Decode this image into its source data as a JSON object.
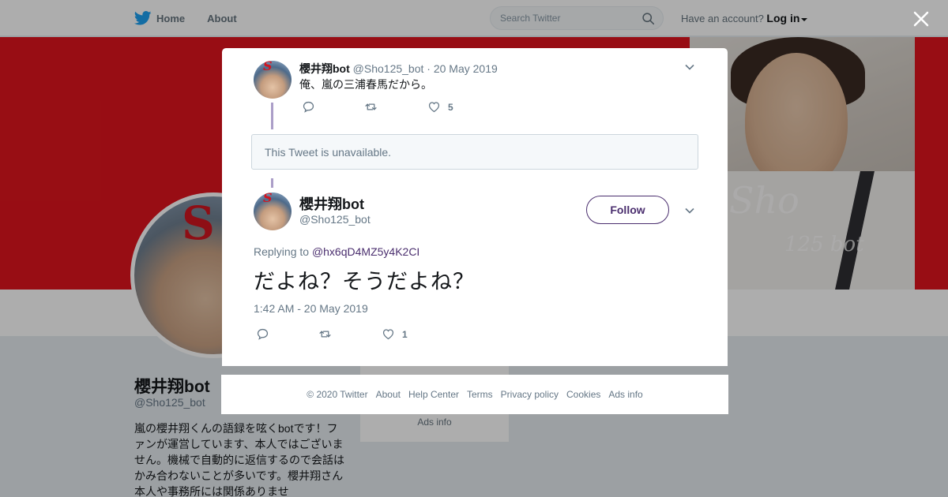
{
  "topbar": {
    "home_label": "Home",
    "about_label": "About",
    "search_placeholder": "Search Twitter",
    "account_prompt": "Have an account?",
    "login_label": "Log in"
  },
  "banner": {
    "signature_main": "Sho",
    "signature_sub": "125 bot"
  },
  "profile": {
    "avatar_logo": "S",
    "name": "櫻井翔bot",
    "handle": "@Sho125_bot",
    "bio": "嵐の櫻井翔くんの語録を呟くbotです！ファンが運営しています、本人ではございません。機械で自動的に返信するので会話はかみ合わないことが多いです。櫻井翔さん本人や事務所には関係ありませ",
    "side_ads_info": "Ads info"
  },
  "modal": {
    "tweet1": {
      "name": "櫻井翔bot",
      "handle": "@Sho125_bot",
      "separator": "·",
      "date": "20 May 2019",
      "text": "俺、嵐の三浦春馬だから。",
      "like_count": "5"
    },
    "unavailable_text": "This Tweet is unavailable.",
    "tweet2": {
      "name": "櫻井翔bot",
      "handle": "@Sho125_bot",
      "follow_label": "Follow",
      "replying_prefix": "Replying to",
      "replying_mention": "@hx6qD4MZ5y4K2CI",
      "text": "だよね？そうだよね？",
      "timestamp": "1:42 AM - 20 May 2019",
      "like_count": "1"
    }
  },
  "footer": {
    "copyright": "© 2020 Twitter",
    "about": "About",
    "help": "Help Center",
    "terms": "Terms",
    "privacy": "Privacy policy",
    "cookies": "Cookies",
    "ads": "Ads info"
  },
  "colors": {
    "banner_red": "#e0141e",
    "twitter_blue": "#1da1f2",
    "follow_purple": "#4a2e6e",
    "thread_line": "#ab9ec8"
  }
}
